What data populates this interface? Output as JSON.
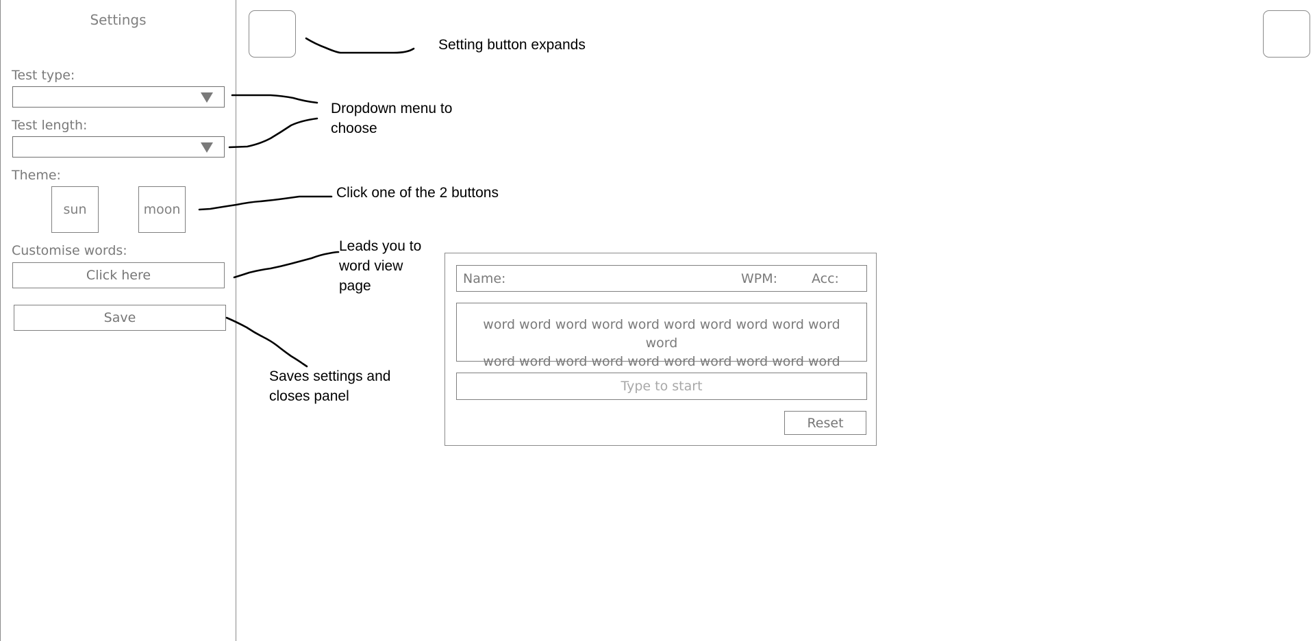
{
  "sidebar": {
    "title": "Settings",
    "test_type": {
      "label": "Test type:",
      "value": ""
    },
    "test_length": {
      "label": "Test length:",
      "value": ""
    },
    "theme": {
      "label": "Theme:",
      "options": [
        "sun",
        "moon"
      ]
    },
    "customise": {
      "label": "Customise words:",
      "button": "Click here"
    },
    "save_label": "Save"
  },
  "annotations": {
    "settings_button": "Setting button expands",
    "dropdown": [
      "Dropdown menu to",
      "choose"
    ],
    "theme": "Click one of the 2 buttons",
    "customise": [
      "Leads you to",
      "word view",
      "page"
    ],
    "save": [
      "Saves settings and",
      "closes panel"
    ]
  },
  "test_panel": {
    "name_label": "Name:",
    "wpm_label": "WPM:",
    "acc_label": "Acc:",
    "words_line1": "word word word word word word word word word word word",
    "words_line2": "word word word word word word word word word word word",
    "input_placeholder": "Type to start",
    "reset_label": "Reset"
  }
}
